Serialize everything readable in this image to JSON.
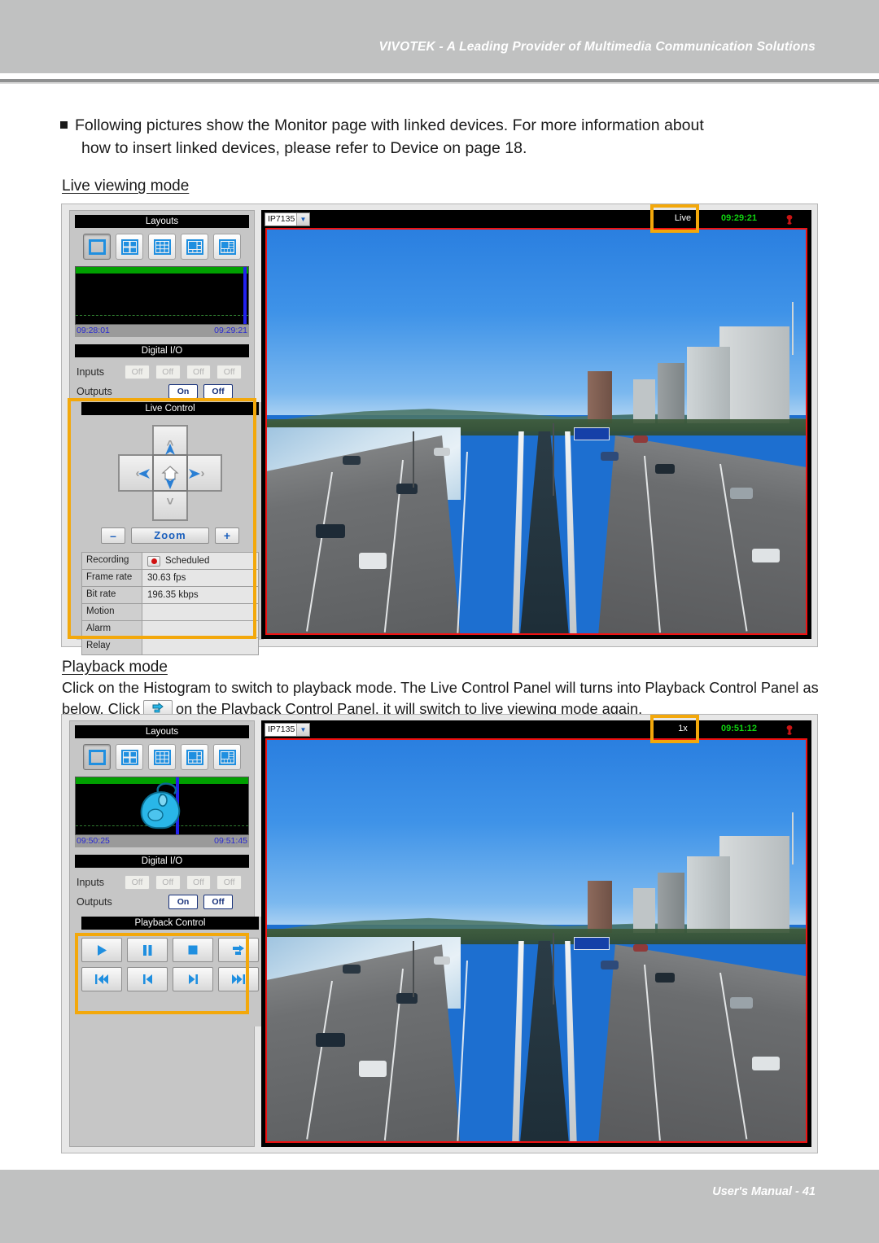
{
  "page": {
    "header_title": "VIVOTEK - A Leading Provider of Multimedia Communication Solutions",
    "footer_text": "User's Manual - 41",
    "header_bg": "#c0c1c1",
    "accent_highlight": "#f3a80b",
    "accent_red": "#ef1212"
  },
  "content": {
    "bullet_line1": "Following pictures show the Monitor page with linked devices. For more information about",
    "bullet_line2": "how to insert linked devices, please refer to Device on page 18.",
    "subhead_live": "Live viewing mode",
    "subhead_playback": "Playback mode",
    "playback_text_a": "Click on the Histogram to switch to playback mode. The Live Control Panel will turns into Playback Control Panel as below. Click",
    "playback_text_b": "on the Playback Control Panel, it will switch to live viewing mode again."
  },
  "live_shot": {
    "layouts": {
      "title": "Layouts",
      "buttons": [
        {
          "name": "layout-1x1",
          "selected": true
        },
        {
          "name": "layout-2x2",
          "selected": false
        },
        {
          "name": "layout-3x3",
          "selected": false
        },
        {
          "name": "layout-2x2-plus",
          "selected": false
        },
        {
          "name": "layout-3x3-plus",
          "selected": false
        }
      ]
    },
    "histogram": {
      "time_start": "09:28:01",
      "time_end": "09:29:21",
      "marker_position_pct": 97,
      "has_mouse_icon": false
    },
    "digital_io": {
      "title": "Digital I/O",
      "inputs_label": "Inputs",
      "outputs_label": "Outputs",
      "inputs": [
        "Off",
        "Off",
        "Off",
        "Off"
      ],
      "outputs": [
        "On",
        "Off"
      ]
    },
    "live_control": {
      "title": "Live Control",
      "zoom_label": "Zoom",
      "zoom_minus": "–",
      "zoom_plus": "+",
      "status": [
        {
          "key": "Recording",
          "value": "Scheduled",
          "has_rec_icon": true
        },
        {
          "key": "Frame rate",
          "value": "30.63 fps",
          "has_rec_icon": false
        },
        {
          "key": "Bit rate",
          "value": "196.35 kbps",
          "has_rec_icon": false
        },
        {
          "key": "Motion",
          "value": "",
          "has_rec_icon": false
        },
        {
          "key": "Alarm",
          "value": "",
          "has_rec_icon": false
        },
        {
          "key": "Relay",
          "value": "",
          "has_rec_icon": false
        }
      ]
    },
    "video": {
      "camera_name": "IP7135",
      "mode_label": "Live",
      "timestamp": "09:29:21",
      "timestamp_color": "#10d410"
    }
  },
  "playback_shot": {
    "layouts": {
      "title": "Layouts",
      "buttons": [
        {
          "name": "layout-1x1",
          "selected": true
        },
        {
          "name": "layout-2x2",
          "selected": false
        },
        {
          "name": "layout-3x3",
          "selected": false
        },
        {
          "name": "layout-2x2-plus",
          "selected": false
        },
        {
          "name": "layout-3x3-plus",
          "selected": false
        }
      ]
    },
    "histogram": {
      "time_start": "09:50:25",
      "time_end": "09:51:45",
      "marker_position_pct": 58,
      "has_mouse_icon": true
    },
    "digital_io": {
      "title": "Digital I/O",
      "inputs_label": "Inputs",
      "outputs_label": "Outputs",
      "inputs": [
        "Off",
        "Off",
        "Off",
        "Off"
      ],
      "outputs": [
        "On",
        "Off"
      ]
    },
    "playback_control": {
      "title": "Playback Control",
      "buttons": [
        {
          "name": "play-button",
          "icon": "play-icon"
        },
        {
          "name": "pause-button",
          "icon": "pause-icon"
        },
        {
          "name": "stop-button",
          "icon": "stop-icon"
        },
        {
          "name": "live-switch-button",
          "icon": "live-switch-icon"
        },
        {
          "name": "rewind-button",
          "icon": "rewind-icon"
        },
        {
          "name": "previous-frame-button",
          "icon": "previous-icon"
        },
        {
          "name": "next-frame-button",
          "icon": "next-icon"
        },
        {
          "name": "fast-forward-button",
          "icon": "fast-forward-icon"
        }
      ]
    },
    "video": {
      "camera_name": "IP7135",
      "mode_label": "1x",
      "timestamp": "09:51:12",
      "timestamp_color": "#10d410"
    }
  }
}
